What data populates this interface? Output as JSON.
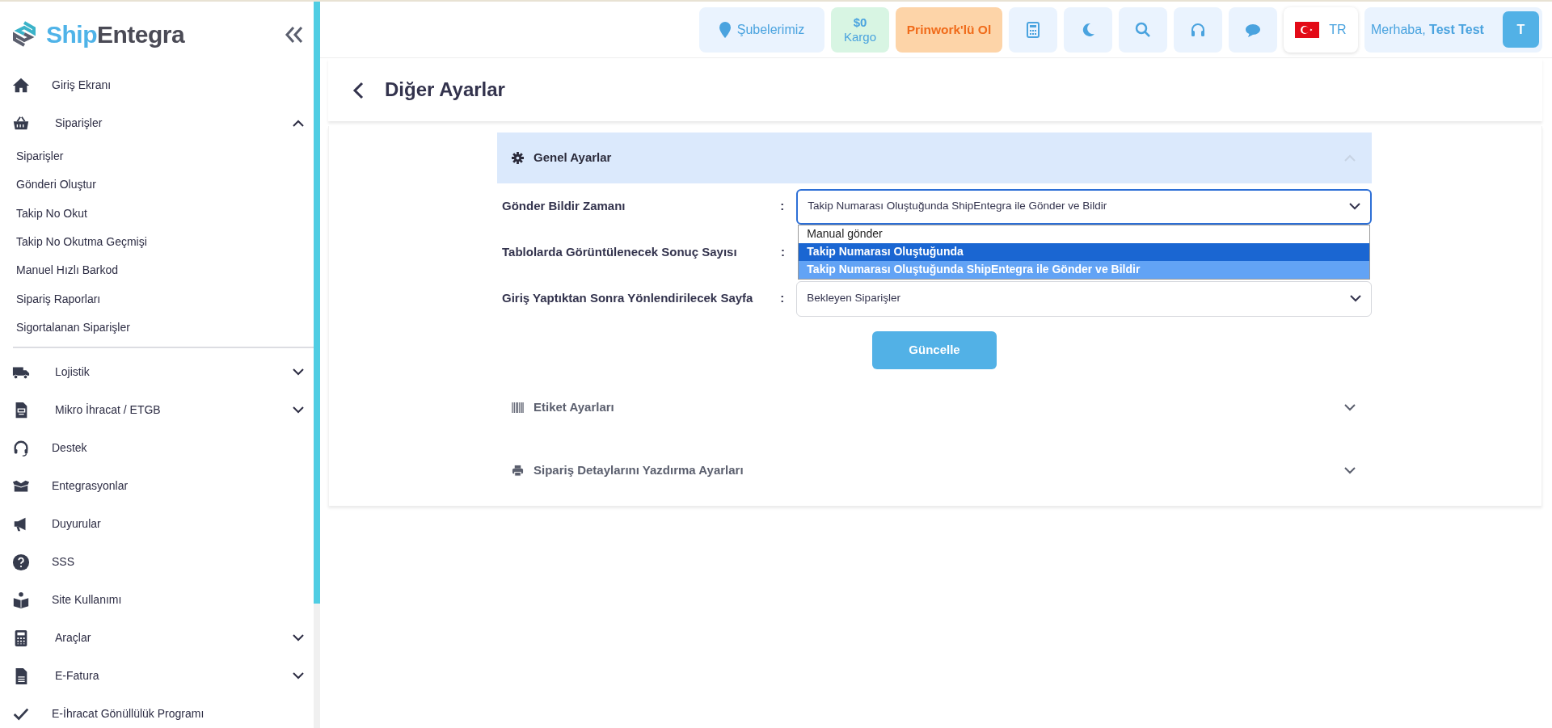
{
  "sidebar": {
    "logo": {
      "first": "Ship",
      "second": "Entegra"
    },
    "items": [
      {
        "label": "Giriş Ekranı"
      },
      {
        "label": "Siparişler",
        "expanded": true,
        "children": [
          {
            "label": "Siparişler"
          },
          {
            "label": "Gönderi Oluştur"
          },
          {
            "label": "Takip No Okut"
          },
          {
            "label": "Takip No Okutma Geçmişi"
          },
          {
            "label": "Manuel Hızlı Barkod"
          },
          {
            "label": "Sipariş Raporları"
          },
          {
            "label": "Sigortalanan Siparişler"
          }
        ]
      },
      {
        "label": "Lojistik",
        "expanded": false
      },
      {
        "label": "Mikro İhracat / ETGB",
        "expanded": false
      },
      {
        "label": "Destek"
      },
      {
        "label": "Entegrasyonlar"
      },
      {
        "label": "Duyurular"
      },
      {
        "label": "SSS"
      },
      {
        "label": "Site Kullanımı"
      },
      {
        "label": "Araçlar",
        "expanded": false
      },
      {
        "label": "E-Fatura",
        "expanded": false
      },
      {
        "label": "E-İhracat Gönüllülük Programı"
      }
    ]
  },
  "header": {
    "branches": {
      "label": "Şubelerimiz"
    },
    "balance": {
      "amount": "$0",
      "label": "Kargo"
    },
    "promo": {
      "label": "Prinwork'lü Ol"
    },
    "language": {
      "code": "TR"
    },
    "user": {
      "greeting": "Merhaba, **Test Test**",
      "initial": "T"
    }
  },
  "page": {
    "title": "Diğer Ayarlar"
  },
  "sections": [
    {
      "title": "Genel Ayarlar",
      "expanded": true,
      "submit": "Güncelle",
      "fields": [
        {
          "label": "Gönder Bildir Zamanı",
          "separator": ":",
          "value": "Takip Numarası Oluştuğunda ShipEntegra ile Gönder ve Bildir",
          "focused": true,
          "options": [
            {
              "label": "Manual gönder",
              "selected": false,
              "highlighted": false
            },
            {
              "label": "Takip Numarası Oluştuğunda",
              "selected": false,
              "highlighted": true
            },
            {
              "label": "Takip Numarası Oluştuğunda ShipEntegra ile Gönder ve Bildir",
              "selected": true,
              "highlighted": false
            }
          ]
        },
        {
          "label": "Tablolarda Görüntülenecek Sonuç Sayısı",
          "separator": ":"
        },
        {
          "label": "Giriş Yaptıktan Sonra Yönlendirilecek Sayfa",
          "separator": ":",
          "value": "Bekleyen Siparişler",
          "focused": false
        }
      ]
    },
    {
      "title": "Etiket Ayarları",
      "expanded": false
    },
    {
      "title": "Sipariş Detaylarını Yazdırma Ayarları",
      "expanded": false
    }
  ]
}
